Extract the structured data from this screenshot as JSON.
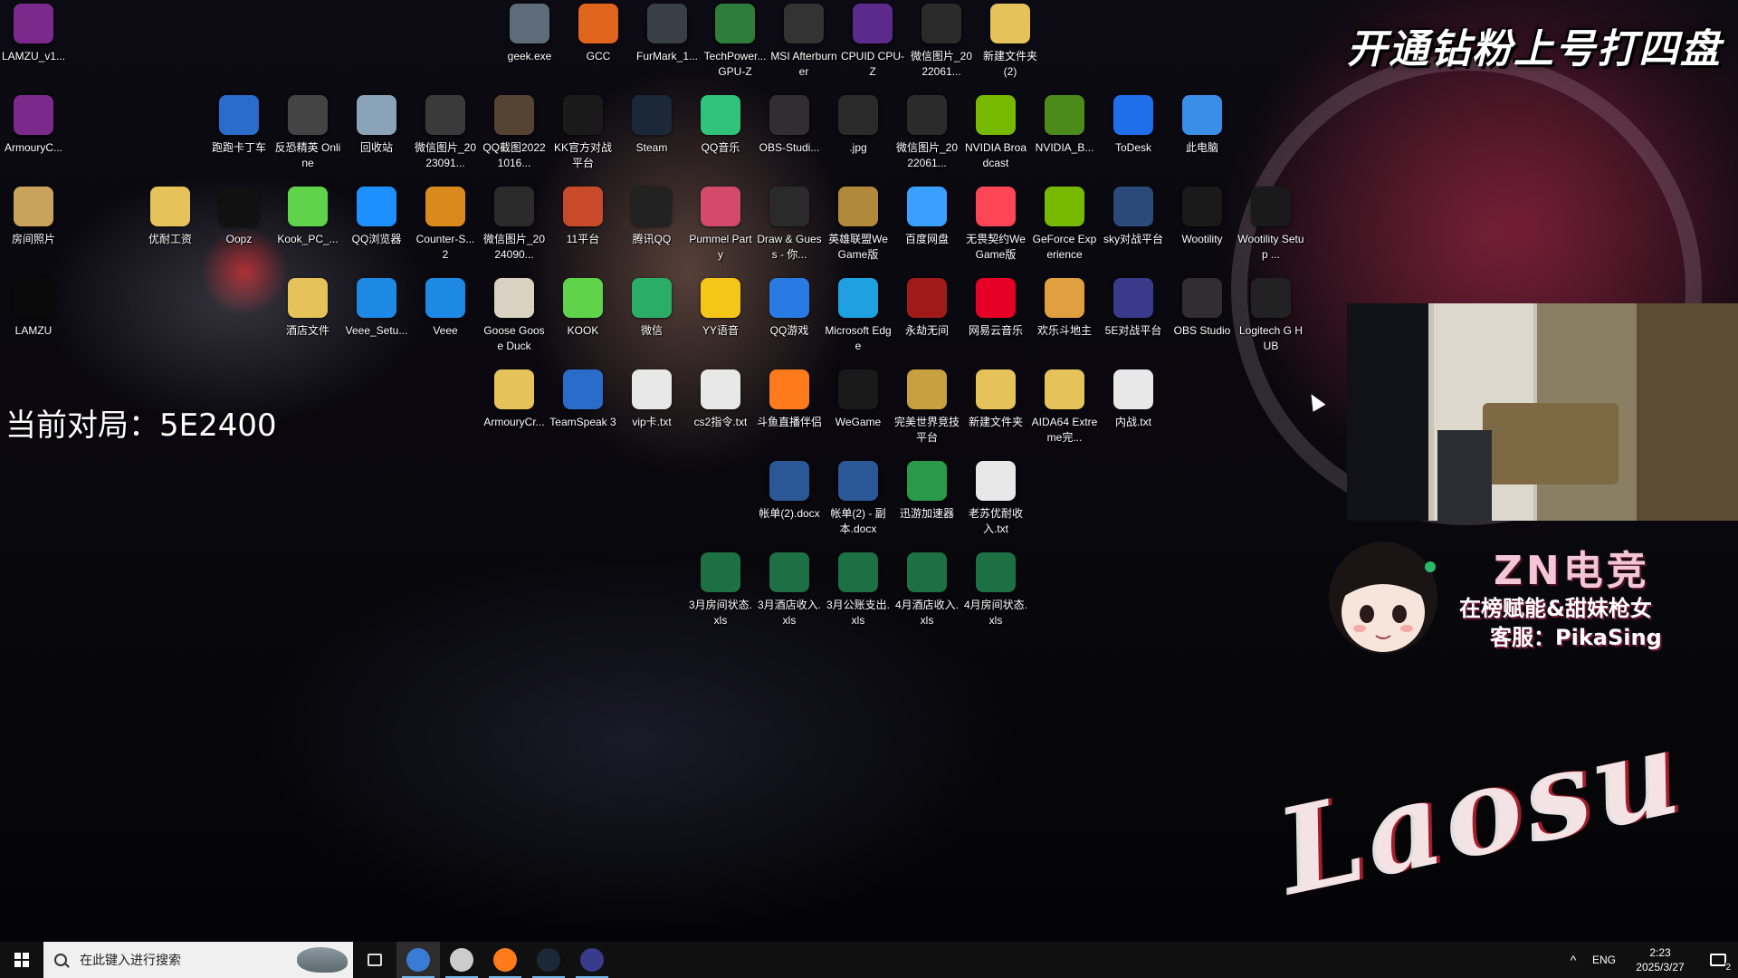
{
  "wallpaper": {
    "promo": "开通钻粉上号打四盘",
    "match": "当前对局：5E2400",
    "brand": "ZN电竞",
    "slogan": "在榜赋能&甜妹枪女",
    "support": "客服：PikaSing",
    "signature": "Laosu"
  },
  "desktop_icons": [
    {
      "label": "LAMZU_v1...",
      "icon": "winrar-icon",
      "color": "#7b2a8c"
    },
    {
      "label": "geek.exe",
      "icon": "trash-can-icon",
      "color": "#5e6b78"
    },
    {
      "label": "GCC",
      "icon": "gcc-icon",
      "color": "#e0641c"
    },
    {
      "label": "FurMark_1...",
      "icon": "furmark-icon",
      "color": "#3a3f47"
    },
    {
      "label": "TechPower... GPU-Z",
      "icon": "gpu-z-icon",
      "color": "#2f7d3a"
    },
    {
      "label": "MSI Afterburner",
      "icon": "msi-afterburner-icon",
      "color": "#333333"
    },
    {
      "label": "CPUID CPU-Z",
      "icon": "cpu-z-icon",
      "color": "#5b2a8a"
    },
    {
      "label": "微信图片_2022061...",
      "icon": "image-file-icon",
      "color": "#2b2b2b"
    },
    {
      "label": "新建文件夹 (2)",
      "icon": "folder-icon",
      "color": "#e6c25a"
    },
    {
      "label": "ArmouryC...",
      "icon": "winrar-icon",
      "color": "#7b2a8c"
    },
    {
      "label": "跑跑卡丁车",
      "icon": "kart-icon",
      "color": "#2a6cc9"
    },
    {
      "label": "反恐精英 Online",
      "icon": "csol-icon",
      "color": "#444444"
    },
    {
      "label": "回收站",
      "icon": "recycle-bin-icon",
      "color": "#8aa3b8"
    },
    {
      "label": "微信图片_2023091...",
      "icon": "image-file-icon",
      "color": "#3a3a3a"
    },
    {
      "label": "QQ截图20221016...",
      "icon": "image-file-icon",
      "color": "#554433"
    },
    {
      "label": "KK官方对战平台",
      "icon": "kk-icon",
      "color": "#1a1a1a"
    },
    {
      "label": "Steam",
      "icon": "steam-icon",
      "color": "#1b2838"
    },
    {
      "label": "QQ音乐",
      "icon": "qq-music-icon",
      "color": "#31c27c"
    },
    {
      "label": "OBS-Studi...",
      "icon": "obs-icon",
      "color": "#302e31"
    },
    {
      "label": ".jpg",
      "icon": "image-file-icon",
      "color": "#2a2a2a"
    },
    {
      "label": "微信图片_2022061...",
      "icon": "image-file-icon",
      "color": "#2b2b2b"
    },
    {
      "label": "NVIDIA Broadcast",
      "icon": "nvidia-icon",
      "color": "#76b900"
    },
    {
      "label": "NVIDIA_B...",
      "icon": "nvidia-icon",
      "color": "#4c8a1a"
    },
    {
      "label": "ToDesk",
      "icon": "todesk-icon",
      "color": "#1f6feb"
    },
    {
      "label": "此电脑",
      "icon": "this-pc-icon",
      "color": "#3a8ee6"
    },
    {
      "label": "房间照片",
      "icon": "zip-folder-icon",
      "color": "#c9a35b"
    },
    {
      "label": "优耐工资",
      "icon": "folder-icon",
      "color": "#e6c25a"
    },
    {
      "label": "Oopz",
      "icon": "oopz-icon",
      "color": "#111111"
    },
    {
      "label": "Kook_PC_...",
      "icon": "kook-icon",
      "color": "#5fd44a"
    },
    {
      "label": "QQ浏览器",
      "icon": "qq-browser-icon",
      "color": "#1e8fff"
    },
    {
      "label": "Counter-S... 2",
      "icon": "cs2-icon",
      "color": "#d98a1c"
    },
    {
      "label": "微信图片_2024090...",
      "icon": "image-file-icon",
      "color": "#2b2b2b"
    },
    {
      "label": "11平台",
      "icon": "11-platform-icon",
      "color": "#c94a2a"
    },
    {
      "label": "腾讯QQ",
      "icon": "qq-icon",
      "color": "#222222"
    },
    {
      "label": "Pummel Party",
      "icon": "pummel-party-icon",
      "color": "#d44a6a"
    },
    {
      "label": "Draw & Guess - 你...",
      "icon": "draw-guess-icon",
      "color": "#2a2a2a"
    },
    {
      "label": "英雄联盟WeGame版",
      "icon": "lol-icon",
      "color": "#b08a3a"
    },
    {
      "label": "百度网盘",
      "icon": "baidu-netdisk-icon",
      "color": "#3aa0ff"
    },
    {
      "label": "无畏契约WeGame版",
      "icon": "valorant-icon",
      "color": "#fd4556"
    },
    {
      "label": "GeForce Experience",
      "icon": "geforce-icon",
      "color": "#76b900"
    },
    {
      "label": "sky对战平台",
      "icon": "sky-icon",
      "color": "#2a4a7a"
    },
    {
      "label": "Wootility",
      "icon": "wootility-icon",
      "color": "#1a1a1a"
    },
    {
      "label": "Wootility Setup ...",
      "icon": "wootility-icon",
      "color": "#1a1a1a"
    },
    {
      "label": "LAMZU",
      "icon": "lamzu-icon",
      "color": "#0a0a0a"
    },
    {
      "label": "酒店文件",
      "icon": "folder-icon",
      "color": "#e6c25a"
    },
    {
      "label": "Veee_Setu...",
      "icon": "veee-icon",
      "color": "#1e88e5"
    },
    {
      "label": "Veee",
      "icon": "veee-icon",
      "color": "#1e88e5"
    },
    {
      "label": "Goose Goose Duck",
      "icon": "goose-icon",
      "color": "#d9d2c2"
    },
    {
      "label": "KOOK",
      "icon": "kook-icon",
      "color": "#5fd44a"
    },
    {
      "label": "微信",
      "icon": "wechat-icon",
      "color": "#2aae67"
    },
    {
      "label": "YY语音",
      "icon": "yy-icon",
      "color": "#f5c518"
    },
    {
      "label": "QQ游戏",
      "icon": "qq-game-icon",
      "color": "#2a7ae4"
    },
    {
      "label": "Microsoft Edge",
      "icon": "edge-icon",
      "color": "#1fa0e0"
    },
    {
      "label": "永劫无间",
      "icon": "naraka-icon",
      "color": "#a01a1a"
    },
    {
      "label": "网易云音乐",
      "icon": "netease-music-icon",
      "color": "#e60026"
    },
    {
      "label": "欢乐斗地主",
      "icon": "landlord-icon",
      "color": "#e0a040"
    },
    {
      "label": "5E对战平台",
      "icon": "5e-icon",
      "color": "#3a3a8a"
    },
    {
      "label": "OBS Studio",
      "icon": "obs-icon",
      "color": "#302e31"
    },
    {
      "label": "Logitech G HUB",
      "icon": "logitech-g-icon",
      "color": "#222222"
    },
    {
      "label": "ArmouryCr...",
      "icon": "folder-icon",
      "color": "#e6c25a"
    },
    {
      "label": "TeamSpeak 3",
      "icon": "teamspeak-icon",
      "color": "#2a6cc9"
    },
    {
      "label": "vip卡.txt",
      "icon": "text-file-icon",
      "color": "#e8e8e8"
    },
    {
      "label": "cs2指令.txt",
      "icon": "text-file-icon",
      "color": "#e8e8e8"
    },
    {
      "label": "斗鱼直播伴侣",
      "icon": "douyu-icon",
      "color": "#ff7a1a"
    },
    {
      "label": "WeGame",
      "icon": "wegame-icon",
      "color": "#1a1a1a"
    },
    {
      "label": "完美世界竞技平台",
      "icon": "perfect-world-icon",
      "color": "#c8a040"
    },
    {
      "label": "新建文件夹",
      "icon": "folder-icon",
      "color": "#e6c25a"
    },
    {
      "label": "AIDA64 Extreme完...",
      "icon": "zip-folder-icon",
      "color": "#e6c25a"
    },
    {
      "label": "内战.txt",
      "icon": "text-file-icon",
      "color": "#e8e8e8"
    },
    {
      "label": "帐单(2).docx",
      "icon": "word-doc-icon",
      "color": "#2b5797"
    },
    {
      "label": "帐单(2) - 副本.docx",
      "icon": "word-doc-icon",
      "color": "#2b5797"
    },
    {
      "label": "迅游加速器",
      "icon": "xunyou-icon",
      "color": "#2a9a4a"
    },
    {
      "label": "老苏优耐收入.txt",
      "icon": "text-file-icon",
      "color": "#e8e8e8"
    },
    {
      "label": "3月房间状态.xls",
      "icon": "excel-icon",
      "color": "#1d7044"
    },
    {
      "label": "3月酒店收入.xls",
      "icon": "excel-icon",
      "color": "#1d7044"
    },
    {
      "label": "3月公账支出.xls",
      "icon": "excel-icon",
      "color": "#1d7044"
    },
    {
      "label": "4月酒店收入.xls",
      "icon": "excel-icon",
      "color": "#1d7044"
    },
    {
      "label": "4月房间状态.xls",
      "icon": "excel-icon",
      "color": "#1d7044"
    }
  ],
  "taskbar": {
    "search_placeholder": "在此键入进行搜索",
    "apps": [
      {
        "name": "cortana-icon",
        "color": "#3a7bd5"
      },
      {
        "name": "obs-icon",
        "color": "#cccccc"
      },
      {
        "name": "douyu-icon",
        "color": "#ff7a1a"
      },
      {
        "name": "steam-icon",
        "color": "#1b2838"
      },
      {
        "name": "5e-icon",
        "color": "#3a3a8a"
      }
    ],
    "language": "ENG",
    "time": "2:23",
    "date": "2025/3/27",
    "notifications": "2"
  }
}
